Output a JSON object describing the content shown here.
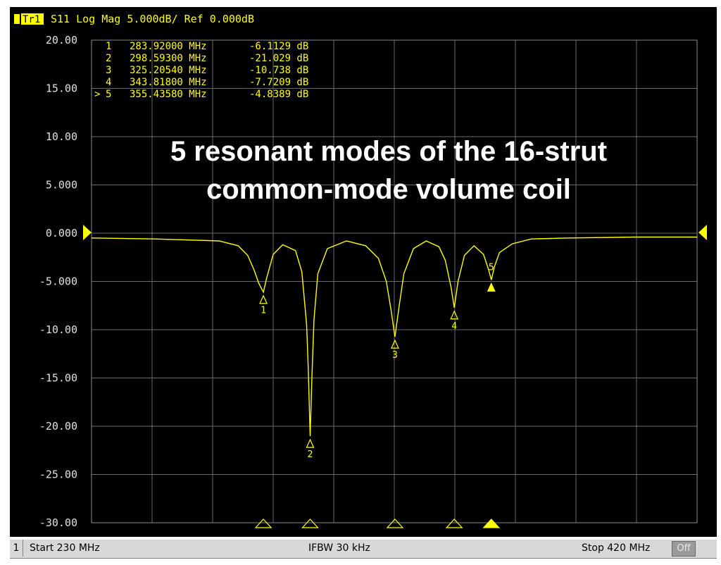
{
  "header": {
    "trace_label": "Tr1",
    "info": "S11 Log Mag 5.000dB/ Ref 0.000dB"
  },
  "annotation": {
    "line1": "5 resonant modes of the 16-strut",
    "line2": "common-mode volume coil"
  },
  "marker_table": [
    {
      "prefix": "",
      "num": "1",
      "freq": "283.92000 MHz",
      "val": "-6.1129 dB"
    },
    {
      "prefix": "",
      "num": "2",
      "freq": "298.59300 MHz",
      "val": "-21.029 dB"
    },
    {
      "prefix": "",
      "num": "3",
      "freq": "325.20540 MHz",
      "val": "-10.738 dB"
    },
    {
      "prefix": "",
      "num": "4",
      "freq": "343.81800 MHz",
      "val": "-7.7209 dB"
    },
    {
      "prefix": ">",
      "num": "5",
      "freq": "355.43580 MHz",
      "val": "-4.8389 dB"
    }
  ],
  "status": {
    "channel": "1",
    "start": "Start 230 MHz",
    "ifbw": "IFBW 30 kHz",
    "stop": "Stop 420 MHz",
    "toggle": "Off"
  },
  "colors": {
    "trace": "#ffff00",
    "grid": "#7a7a7a",
    "background": "#000000",
    "marker_active": "#ffff00"
  },
  "chart_data": {
    "type": "line",
    "x_range_mhz": [
      230,
      420
    ],
    "ylim": [
      -30,
      20
    ],
    "y_ticks": [
      "20.00",
      "15.00",
      "10.00",
      "5.000",
      "0.000",
      "-5.000",
      "-10.00",
      "-15.00",
      "-20.00",
      "-25.00",
      "-30.00"
    ],
    "y_tick_values": [
      20,
      15,
      10,
      5,
      0,
      -5,
      -10,
      -15,
      -20,
      -25,
      -30
    ],
    "reference_level": 0,
    "grid": true,
    "series": [
      {
        "x": [
          230,
          250,
          270,
          276,
          279,
          281,
          282.5,
          283.92,
          285,
          287,
          290,
          294,
          296,
          297.5,
          298.0,
          298.59,
          299.2,
          299.8,
          301,
          304,
          310,
          316,
          320,
          322.5,
          324,
          325.2,
          326.5,
          328,
          331,
          335,
          339,
          341,
          342.8,
          343.82,
          345,
          347,
          350,
          353,
          354.6,
          355.44,
          356.4,
          358,
          362,
          368,
          380,
          400,
          420
        ],
        "y": [
          -0.5,
          -0.6,
          -0.8,
          -1.3,
          -2.3,
          -3.8,
          -5.2,
          -6.11,
          -4.6,
          -2.2,
          -1.2,
          -1.8,
          -4.0,
          -9.5,
          -14.0,
          -21.03,
          -14.5,
          -9.0,
          -4.2,
          -1.6,
          -0.8,
          -1.3,
          -2.6,
          -5.0,
          -8.0,
          -10.74,
          -7.6,
          -4.2,
          -1.6,
          -0.8,
          -1.4,
          -2.8,
          -5.6,
          -7.72,
          -5.0,
          -2.3,
          -1.3,
          -2.2,
          -3.8,
          -4.84,
          -3.5,
          -2.0,
          -1.1,
          -0.6,
          -0.5,
          -0.4,
          -0.4
        ]
      }
    ],
    "markers": [
      {
        "num": "1",
        "x": 283.92,
        "y": -6.1129,
        "active": false
      },
      {
        "num": "2",
        "x": 298.593,
        "y": -21.029,
        "active": false
      },
      {
        "num": "3",
        "x": 325.2054,
        "y": -10.738,
        "active": false
      },
      {
        "num": "4",
        "x": 343.818,
        "y": -7.7209,
        "active": false
      },
      {
        "num": "5",
        "x": 355.4358,
        "y": -4.8389,
        "active": true
      }
    ]
  }
}
